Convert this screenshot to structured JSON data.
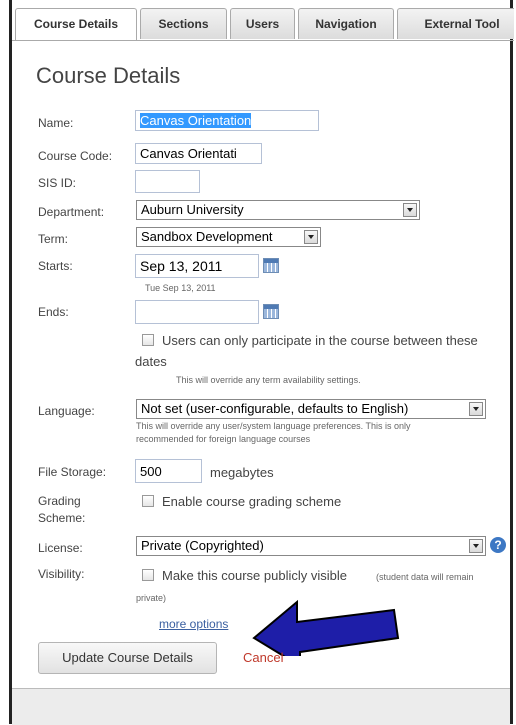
{
  "tabs": [
    "Course Details",
    "Sections",
    "Users",
    "Navigation",
    "External Tool"
  ],
  "page_title": "Course Details",
  "fields": {
    "name_label": "Name:",
    "name_value": "Canvas Orientation",
    "course_code_label": "Course Code:",
    "course_code_value": "Canvas Orientati",
    "sis_id_label": "SIS ID:",
    "department_label": "Department:",
    "department_value": "Auburn University",
    "term_label": "Term:",
    "term_value": "Sandbox Development",
    "starts_label": "Starts:",
    "starts_value": "Sep 13, 2011",
    "starts_hint": "Tue Sep 13, 2011",
    "ends_label": "Ends:",
    "participate_text_1": "Users can only participate in the course between these",
    "participate_text_2": "dates",
    "participate_note": "This will override any term availability settings.",
    "language_label": "Language:",
    "language_value": "Not set (user-configurable, defaults to English)",
    "language_note_1": "This will override any user/system language preferences. This is only",
    "language_note_2": "recommended for foreign language courses",
    "file_storage_label": "File Storage:",
    "file_storage_value": "500",
    "file_storage_unit": "megabytes",
    "grading_label_1": "Grading",
    "grading_label_2": "Scheme:",
    "grading_text": "Enable course grading scheme",
    "license_label": "License:",
    "license_value": "Private (Copyrighted)",
    "visibility_label": "Visibility:",
    "visibility_text": "Make this course publicly visible",
    "visibility_note_1": "(student data will remain",
    "visibility_note_2": "private)"
  },
  "more_options": "more options",
  "update_button": "Update Course Details",
  "cancel": "Cancel",
  "icons": {
    "calendar": "calendar-icon",
    "help": "?",
    "arrow": "blue-arrow-pointing-left"
  },
  "colors": {
    "arrow": "#1e1ea8",
    "link": "#3a5fa0",
    "cancel": "#c0392b",
    "selection": "#3399ff"
  }
}
